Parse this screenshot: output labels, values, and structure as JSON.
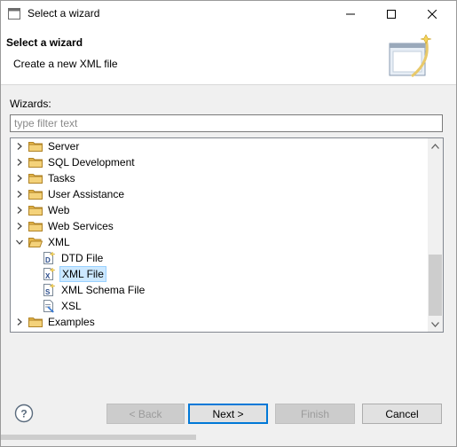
{
  "window": {
    "title": "Select a wizard"
  },
  "banner": {
    "heading": "Select a wizard",
    "description": "Create a new XML file"
  },
  "wizards": {
    "label": "Wizards:",
    "filter_placeholder": "type filter text",
    "filter_value": ""
  },
  "tree": {
    "items": [
      {
        "label": "Server",
        "type": "folder",
        "expanded": false
      },
      {
        "label": "SQL Development",
        "type": "folder",
        "expanded": false
      },
      {
        "label": "Tasks",
        "type": "folder",
        "expanded": false
      },
      {
        "label": "User Assistance",
        "type": "folder",
        "expanded": false
      },
      {
        "label": "Web",
        "type": "folder",
        "expanded": false
      },
      {
        "label": "Web Services",
        "type": "folder",
        "expanded": false
      },
      {
        "label": "XML",
        "type": "folder",
        "expanded": true
      },
      {
        "label": "DTD File",
        "type": "file",
        "icon": "dtd-file-icon"
      },
      {
        "label": "XML File",
        "type": "file",
        "icon": "xml-file-icon",
        "selected": true
      },
      {
        "label": "XML Schema File",
        "type": "file",
        "icon": "xml-schema-file-icon"
      },
      {
        "label": "XSL",
        "type": "file",
        "icon": "xsl-file-icon"
      },
      {
        "label": "Examples",
        "type": "folder",
        "expanded": false
      }
    ]
  },
  "buttons": {
    "back": "< Back",
    "next": "Next >",
    "finish": "Finish",
    "cancel": "Cancel"
  },
  "colors": {
    "selection": "#cce8ff",
    "default_button_border": "#0078d7",
    "folder": "#e8b84a"
  }
}
